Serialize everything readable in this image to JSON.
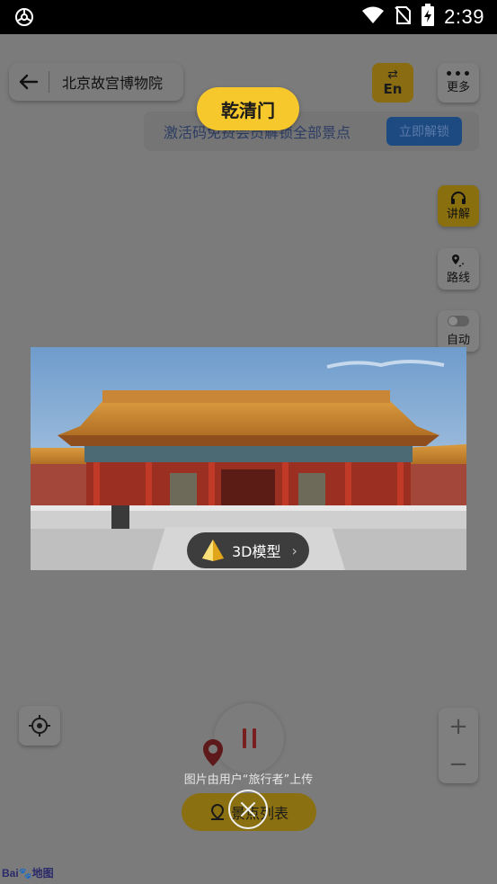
{
  "status_bar": {
    "time": "2:39",
    "icons": [
      "app-notification-icon",
      "wifi-icon",
      "no-sim-icon",
      "battery-charging-icon"
    ]
  },
  "header": {
    "back_icon": "arrow-left-icon",
    "title": "北京故宫博物院",
    "language_button": {
      "icon": "swap-icon",
      "label": "En"
    },
    "more_button": {
      "icon": "more-dots-icon",
      "label": "更多"
    }
  },
  "unlock_banner": {
    "text": "激活码免费会员解锁全部景点",
    "button_label": "立即解锁"
  },
  "side_tools": [
    {
      "id": "narrate",
      "icon": "headphones-icon",
      "label": "讲解"
    },
    {
      "id": "route",
      "icon": "route-pin-icon",
      "label": "路线"
    },
    {
      "id": "auto",
      "icon": "toggle-icon",
      "label": "自动"
    }
  ],
  "map_controls": {
    "locate_icon": "crosshair-icon",
    "zoom_in": "+",
    "zoom_out": "−",
    "play_state": "paused",
    "spot_list_label": "景点列表",
    "spot_list_icon": "pin-list-icon",
    "logo_text": "Bai",
    "logo_suffix": "地图"
  },
  "popup": {
    "title": "乾清门",
    "model_button_label": "3D模型",
    "model_icon": "pyramid-icon",
    "caption": "图片由用户“旅行者”上传",
    "close_icon": "close-icon"
  },
  "colors": {
    "accent_yellow": "#f7c82b",
    "dim_background": "#7a7a7a",
    "unlock_blue": "#1e4a82"
  }
}
